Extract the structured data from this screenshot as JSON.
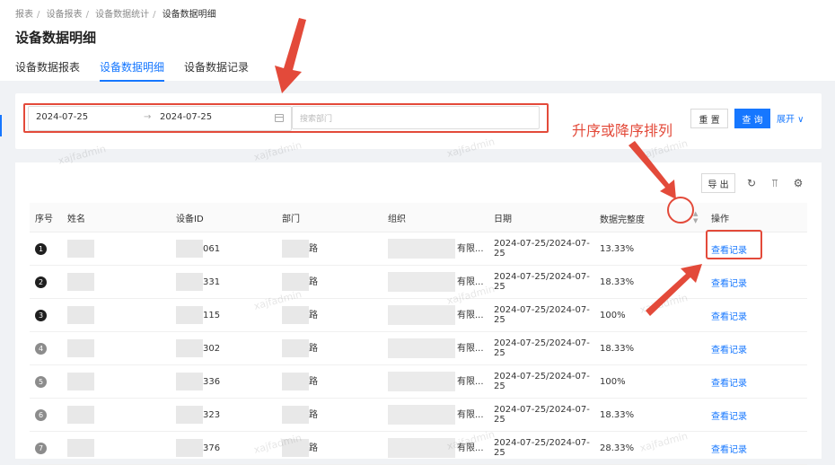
{
  "breadcrumb": [
    "报表",
    "设备报表",
    "设备数据统计",
    "设备数据明细"
  ],
  "page_title": "设备数据明细",
  "tabs": [
    {
      "label": "设备数据报表",
      "active": false
    },
    {
      "label": "设备数据明细",
      "active": true
    },
    {
      "label": "设备数据记录",
      "active": false
    }
  ],
  "filter": {
    "start_date": "2024-07-25",
    "end_date": "2024-07-25",
    "range_arrow": "→",
    "dept_placeholder": "搜索部门",
    "reset_label": "重 置",
    "query_label": "查 询",
    "expand_label": "展开 ∨"
  },
  "toolbar": {
    "export_label": "导 出",
    "refresh_icon": "↻",
    "density_icon": "⫪",
    "settings_icon": "⚙"
  },
  "annotation": {
    "text": "升序或降序排列",
    "color": "#e34a3a"
  },
  "watermark": "xajfadmin",
  "table": {
    "headers": [
      "序号",
      "姓名",
      "设备ID",
      "部门",
      "组织",
      "日期",
      "数据完整度",
      "操作"
    ],
    "rows": [
      {
        "idx": "1",
        "device": "061",
        "dept": "路",
        "org": "有限...",
        "date": "2024-07-25/2024-07-25",
        "completeness": "13.33%",
        "action": "查看记录"
      },
      {
        "idx": "2",
        "device": "331",
        "dept": "路",
        "org": "有限...",
        "date": "2024-07-25/2024-07-25",
        "completeness": "18.33%",
        "action": "查看记录"
      },
      {
        "idx": "3",
        "device": "115",
        "dept": "路",
        "org": "有限...",
        "date": "2024-07-25/2024-07-25",
        "completeness": "100%",
        "action": "查看记录"
      },
      {
        "idx": "4",
        "device": "302",
        "dept": "路",
        "org": "有限...",
        "date": "2024-07-25/2024-07-25",
        "completeness": "18.33%",
        "action": "查看记录"
      },
      {
        "idx": "5",
        "device": "336",
        "dept": "路",
        "org": "有限...",
        "date": "2024-07-25/2024-07-25",
        "completeness": "100%",
        "action": "查看记录"
      },
      {
        "idx": "6",
        "device": "323",
        "dept": "路",
        "org": "有限...",
        "date": "2024-07-25/2024-07-25",
        "completeness": "18.33%",
        "action": "查看记录"
      },
      {
        "idx": "7",
        "device": "376",
        "dept": "路",
        "org": "有限...",
        "date": "2024-07-25/2024-07-25",
        "completeness": "28.33%",
        "action": "查看记录"
      }
    ]
  }
}
